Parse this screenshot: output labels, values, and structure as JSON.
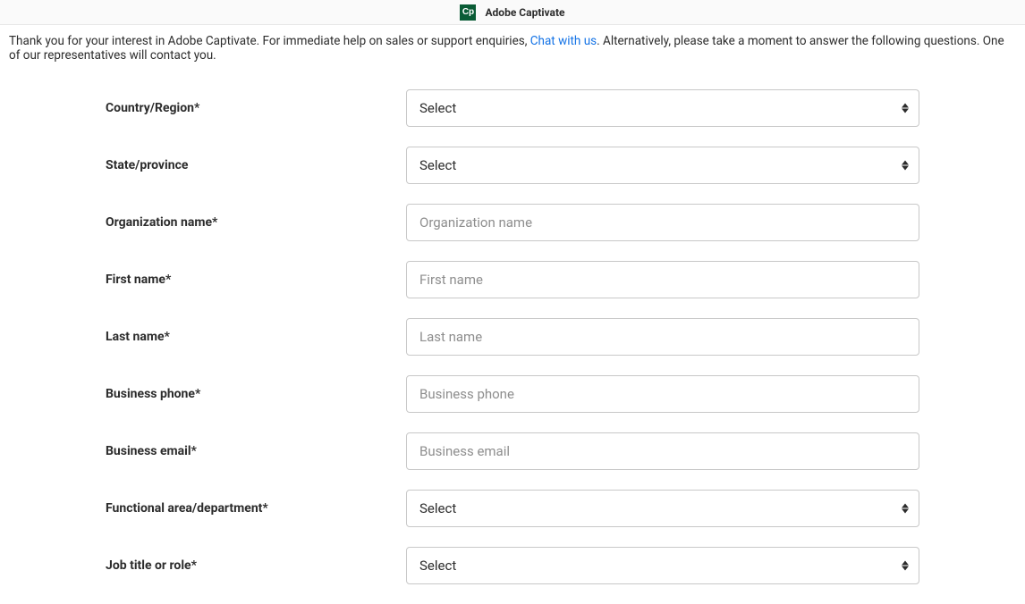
{
  "header": {
    "logo_text": "Cp",
    "title": "Adobe Captivate"
  },
  "intro": {
    "text_before": "Thank you for your interest in Adobe Captivate. For immediate help on sales or support enquiries, ",
    "link_text": "Chat with us",
    "text_after": ". Alternatively, please take a moment to answer the following questions. One of our representatives will contact you."
  },
  "form": {
    "country": {
      "label": "Country/Region*",
      "value": "Select"
    },
    "state": {
      "label": "State/province",
      "value": "Select"
    },
    "org": {
      "label": "Organization name*",
      "placeholder": "Organization name"
    },
    "first_name": {
      "label": "First name*",
      "placeholder": "First name"
    },
    "last_name": {
      "label": "Last name*",
      "placeholder": "Last name"
    },
    "phone": {
      "label": "Business phone*",
      "placeholder": "Business phone"
    },
    "email": {
      "label": "Business email*",
      "placeholder": "Business email"
    },
    "dept": {
      "label": "Functional area/department*",
      "value": "Select"
    },
    "role": {
      "label": "Job title or role*",
      "value": "Select"
    }
  }
}
